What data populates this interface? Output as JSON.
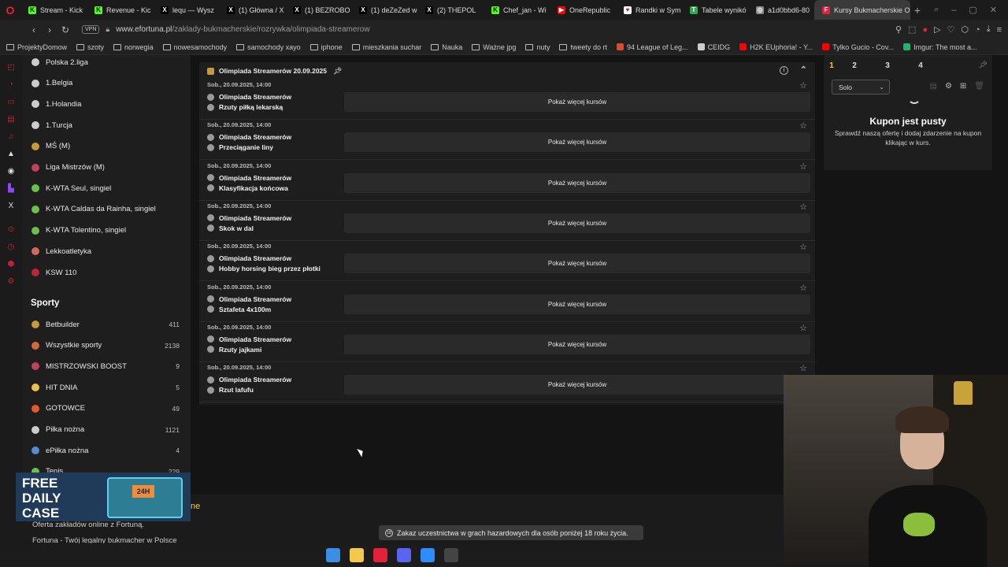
{
  "browser": {
    "tabs": [
      {
        "label": "Stream - Kick",
        "color": "#53fc18",
        "glyph": "K"
      },
      {
        "label": "Revenue - Kic",
        "color": "#53fc18",
        "glyph": "K"
      },
      {
        "label": "lequ — Wysz",
        "color": "#000000",
        "glyph": "X"
      },
      {
        "label": "(1) Główna / X",
        "color": "#000000",
        "glyph": "X"
      },
      {
        "label": "(1) BEZROBO",
        "color": "#000000",
        "glyph": "X"
      },
      {
        "label": "(1) deZeZed w",
        "color": "#000000",
        "glyph": "X"
      },
      {
        "label": "(2) THEPOL",
        "color": "#000000",
        "glyph": "X"
      },
      {
        "label": "Chef_jan - Wi",
        "color": "#53fc18",
        "glyph": "K"
      },
      {
        "label": "OneRepublic",
        "color": "#ff0000",
        "glyph": "▶"
      },
      {
        "label": "Randki w Sym",
        "color": "#ffffff",
        "glyph": "♥"
      },
      {
        "label": "Tabele wynikó",
        "color": "#2fa84f",
        "glyph": "T"
      },
      {
        "label": "a1d0bbd6-80",
        "color": "#888888",
        "glyph": "◎"
      },
      {
        "label": "Kursy Bukmacherskie Ol",
        "color": "#e0223a",
        "glyph": "F"
      }
    ],
    "active_tab_index": 12,
    "new_tab": "+",
    "url_host": "www.efortuna.pl",
    "url_path": "/zaklady-bukmacherskie/rozrywka/olimpiada-streamerow",
    "vpn": "VPN"
  },
  "bookmarks": [
    {
      "label": "ProjektyDomow",
      "kind": "folder"
    },
    {
      "label": "szoty",
      "kind": "folder"
    },
    {
      "label": "norwegia",
      "kind": "folder"
    },
    {
      "label": "nowesamochody",
      "kind": "folder"
    },
    {
      "label": "samochody xayo",
      "kind": "folder"
    },
    {
      "label": "iphone",
      "kind": "folder"
    },
    {
      "label": "mieszkania suchar",
      "kind": "folder"
    },
    {
      "label": "Nauka",
      "kind": "folder"
    },
    {
      "label": "Ważne jpg",
      "kind": "folder"
    },
    {
      "label": "nuty",
      "kind": "folder"
    },
    {
      "label": "tweety do rt",
      "kind": "folder"
    },
    {
      "label": "94 League of Leg...",
      "kind": "site",
      "color": "#e04a2a"
    },
    {
      "label": "CEIDG",
      "kind": "site",
      "color": "#cccccc"
    },
    {
      "label": "H2K EUphoria! - Y...",
      "kind": "site",
      "color": "#ff0000"
    },
    {
      "label": "Tylko Gucio - Cov...",
      "kind": "site",
      "color": "#ff0000"
    },
    {
      "label": "Imgur: The most a...",
      "kind": "site",
      "color": "#1bb76e"
    }
  ],
  "leftnav": {
    "top_items": [
      {
        "label": "Polska 2.liga",
        "icon": "soccer-ball",
        "color": "#cccccc"
      },
      {
        "label": "1.Belgia",
        "icon": "soccer-ball",
        "color": "#cccccc"
      },
      {
        "label": "1.Holandia",
        "icon": "soccer-ball",
        "color": "#cccccc"
      },
      {
        "label": "1.Turcja",
        "icon": "soccer-ball",
        "color": "#cccccc"
      },
      {
        "label": "MŚ (M)",
        "icon": "trophy",
        "color": "#c59a3a"
      },
      {
        "label": "Liga Mistrzów (M)",
        "icon": "ucl-ball",
        "color": "#c04060"
      },
      {
        "label": "K-WTA Seul, singiel",
        "icon": "tennis-ball",
        "color": "#6cc04a"
      },
      {
        "label": "K-WTA Caldas da Rainha, singiel",
        "icon": "tennis-ball",
        "color": "#6cc04a"
      },
      {
        "label": "K-WTA Tolentino, singiel",
        "icon": "tennis-ball",
        "color": "#6cc04a"
      },
      {
        "label": "Lekkoatletyka",
        "icon": "runner",
        "color": "#d06a5a"
      },
      {
        "label": "KSW 110",
        "icon": "ksw",
        "color": "#c0223a"
      }
    ],
    "sports_title": "Sporty",
    "sports": [
      {
        "label": "Betbuilder",
        "count": "411",
        "icon": "betbuilder",
        "color": "#c59a3a"
      },
      {
        "label": "Wszystkie sporty",
        "count": "2138",
        "icon": "all-sports",
        "color": "#d06a3a"
      },
      {
        "label": "MISTRZOWSKI BOOST",
        "count": "9",
        "icon": "boost",
        "color": "#c04060"
      },
      {
        "label": "HIT DNIA",
        "count": "5",
        "icon": "hit",
        "color": "#e8c04a"
      },
      {
        "label": "GOTOWCE",
        "count": "49",
        "icon": "fire",
        "color": "#e05a2a"
      },
      {
        "label": "Piłka nożna",
        "count": "1121",
        "icon": "soccer-ball",
        "color": "#cccccc"
      },
      {
        "label": "ePiłka nożna",
        "count": "4",
        "icon": "esoccer",
        "color": "#5a8ad0"
      },
      {
        "label": "Tenis",
        "count": "229",
        "icon": "tennis-ball",
        "color": "#6cc04a"
      }
    ]
  },
  "promo": {
    "line1": "FREE",
    "line2": "DAILY",
    "line3": "CASE",
    "badge": "24H"
  },
  "footer": {
    "ne": "ne",
    "line1": "Oferta zakładów online z Fortuną.",
    "line2": "Fortuna - Twój legalny bukmacher w Polsce"
  },
  "main": {
    "header": "Olimpiada Streamerów 20.09.2025",
    "events": [
      {
        "date": "Sob., 20.09.2025, 14:00",
        "team1": "Olimpiada Streamerów",
        "team2": "Rzuty piłką lekarską",
        "odds": "Pokaż więcej kursów"
      },
      {
        "date": "Sob., 20.09.2025, 14:00",
        "team1": "Olimpiada Streamerów",
        "team2": "Przeciąganie liny",
        "odds": "Pokaż więcej kursów"
      },
      {
        "date": "Sob., 20.09.2025, 14:00",
        "team1": "Olimpiada Streamerów",
        "team2": "Klasyfikacja końcowa",
        "odds": "Pokaż więcej kursów"
      },
      {
        "date": "Sob., 20.09.2025, 14:00",
        "team1": "Olimpiada Streamerów",
        "team2": "Skok w dal",
        "odds": "Pokaż więcej kursów"
      },
      {
        "date": "Sob., 20.09.2025, 14:00",
        "team1": "Olimpiada Streamerów",
        "team2": "Hobby horsing bieg przez płotki",
        "odds": "Pokaż więcej kursów"
      },
      {
        "date": "Sob., 20.09.2025, 14:00",
        "team1": "Olimpiada Streamerów",
        "team2": "Sztafeta 4x100m",
        "odds": "Pokaż więcej kursów"
      },
      {
        "date": "Sob., 20.09.2025, 14:00",
        "team1": "Olimpiada Streamerów",
        "team2": "Rzuty jajkami",
        "odds": "Pokaż więcej kursów"
      },
      {
        "date": "Sob., 20.09.2025, 14:00",
        "team1": "Olimpiada Streamerów",
        "team2": "Rzut lafufu",
        "odds": "Pokaż więcej kursów"
      }
    ]
  },
  "coupon": {
    "tabs": [
      "1",
      "2",
      "3",
      "4"
    ],
    "active_tab": "1",
    "mode": "Solo",
    "empty_title": "Kupon jest pusty",
    "empty_desc": "Sprawdź naszą ofertę i dodaj zdarzenie na kupon klikając w kurs."
  },
  "warning": {
    "age": "18",
    "text": "Zakaz uczestnictwa w grach hazardowych dla osób poniżej 18 roku życia."
  },
  "taskbar": [
    {
      "name": "windows-start",
      "color": "#3a8ee6"
    },
    {
      "name": "file-explorer",
      "color": "#f2c94c"
    },
    {
      "name": "opera-gx",
      "color": "#e0223a"
    },
    {
      "name": "discord",
      "color": "#5865f2"
    },
    {
      "name": "messenger",
      "color": "#2f8cff"
    },
    {
      "name": "app-red",
      "color": "#444444"
    }
  ]
}
